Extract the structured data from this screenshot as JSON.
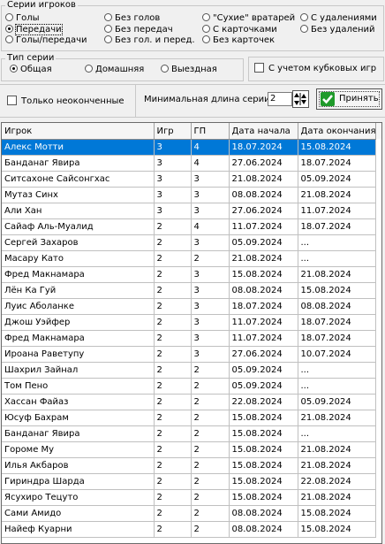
{
  "series_group": {
    "legend": "Серии игроков",
    "options": [
      {
        "label": "Голы",
        "checked": false
      },
      {
        "label": "Передачи",
        "checked": true
      },
      {
        "label": "Голы/передачи",
        "checked": false
      },
      {
        "label": "Без голов",
        "checked": false
      },
      {
        "label": "Без передач",
        "checked": false
      },
      {
        "label": "Без гол. и перед.",
        "checked": false
      },
      {
        "label": "\"Сухие\" вратарей",
        "checked": false
      },
      {
        "label": "С карточками",
        "checked": false
      },
      {
        "label": "Без карточек",
        "checked": false
      },
      {
        "label": "С удалениями",
        "checked": false
      },
      {
        "label": "Без удалений",
        "checked": false
      }
    ]
  },
  "type_group": {
    "legend": "Тип серии",
    "options": [
      {
        "label": "Общая",
        "checked": true
      },
      {
        "label": "Домашняя",
        "checked": false
      },
      {
        "label": "Выездная",
        "checked": false
      }
    ]
  },
  "cup_checkbox": {
    "label": "С учетом кубковых игр",
    "checked": false
  },
  "unfinished_checkbox": {
    "label": "Только неоконченные",
    "checked": false
  },
  "min_length": {
    "label": "Минимальная длина серии",
    "value": "2"
  },
  "apply_button": {
    "label": "Принять"
  },
  "table": {
    "columns": [
      "Игрок",
      "Игр",
      "ГП",
      "Дата начала",
      "Дата окончания"
    ],
    "rows": [
      [
        "Алекс Мотти",
        "3",
        "4",
        "18.07.2024",
        "15.08.2024"
      ],
      [
        "Банданаг Явира",
        "3",
        "4",
        "27.06.2024",
        "18.07.2024"
      ],
      [
        "Ситсахоне Сайсонгхас",
        "3",
        "3",
        "21.08.2024",
        "05.09.2024"
      ],
      [
        "Мутаз Синх",
        "3",
        "3",
        "08.08.2024",
        "21.08.2024"
      ],
      [
        "Али Хан",
        "3",
        "3",
        "27.06.2024",
        "11.07.2024"
      ],
      [
        "Сайаф Аль-Муалид",
        "2",
        "4",
        "11.07.2024",
        "18.07.2024"
      ],
      [
        "Сергей Захаров",
        "2",
        "3",
        "05.09.2024",
        "..."
      ],
      [
        "Масару Като",
        "2",
        "2",
        "21.08.2024",
        "..."
      ],
      [
        "Фред Макнамара",
        "2",
        "3",
        "15.08.2024",
        "21.08.2024"
      ],
      [
        "Лён Ка Гуй",
        "2",
        "3",
        "08.08.2024",
        "15.08.2024"
      ],
      [
        "Луис Аболанке",
        "2",
        "3",
        "18.07.2024",
        "08.08.2024"
      ],
      [
        "Джош Уэйфер",
        "2",
        "3",
        "11.07.2024",
        "18.07.2024"
      ],
      [
        "Фред Макнамара",
        "2",
        "3",
        "11.07.2024",
        "18.07.2024"
      ],
      [
        "Ироана Раветупу",
        "2",
        "3",
        "27.06.2024",
        "10.07.2024"
      ],
      [
        "Шахрил Зайнал",
        "2",
        "2",
        "05.09.2024",
        "..."
      ],
      [
        "Том Пено",
        "2",
        "2",
        "05.09.2024",
        "..."
      ],
      [
        "Хассан Файаз",
        "2",
        "2",
        "22.08.2024",
        "05.09.2024"
      ],
      [
        "Юсуф Бахрам",
        "2",
        "2",
        "15.08.2024",
        "21.08.2024"
      ],
      [
        "Банданаг Явира",
        "2",
        "2",
        "15.08.2024",
        "..."
      ],
      [
        "Гороме Му",
        "2",
        "2",
        "15.08.2024",
        "21.08.2024"
      ],
      [
        "Илья Акбаров",
        "2",
        "2",
        "15.08.2024",
        "21.08.2024"
      ],
      [
        "Гириндра Шарда",
        "2",
        "2",
        "15.08.2024",
        "22.08.2024"
      ],
      [
        "Ясухиро Тецуто",
        "2",
        "2",
        "15.08.2024",
        "21.08.2024"
      ],
      [
        "Сами Амидо",
        "2",
        "2",
        "08.08.2024",
        "15.08.2024"
      ],
      [
        "Найеф Куарни",
        "2",
        "2",
        "08.08.2024",
        "15.08.2024"
      ]
    ],
    "selected_row": 0
  },
  "colors": {
    "selection": "#0078d7",
    "apply_icon": "#1f9a2a"
  }
}
